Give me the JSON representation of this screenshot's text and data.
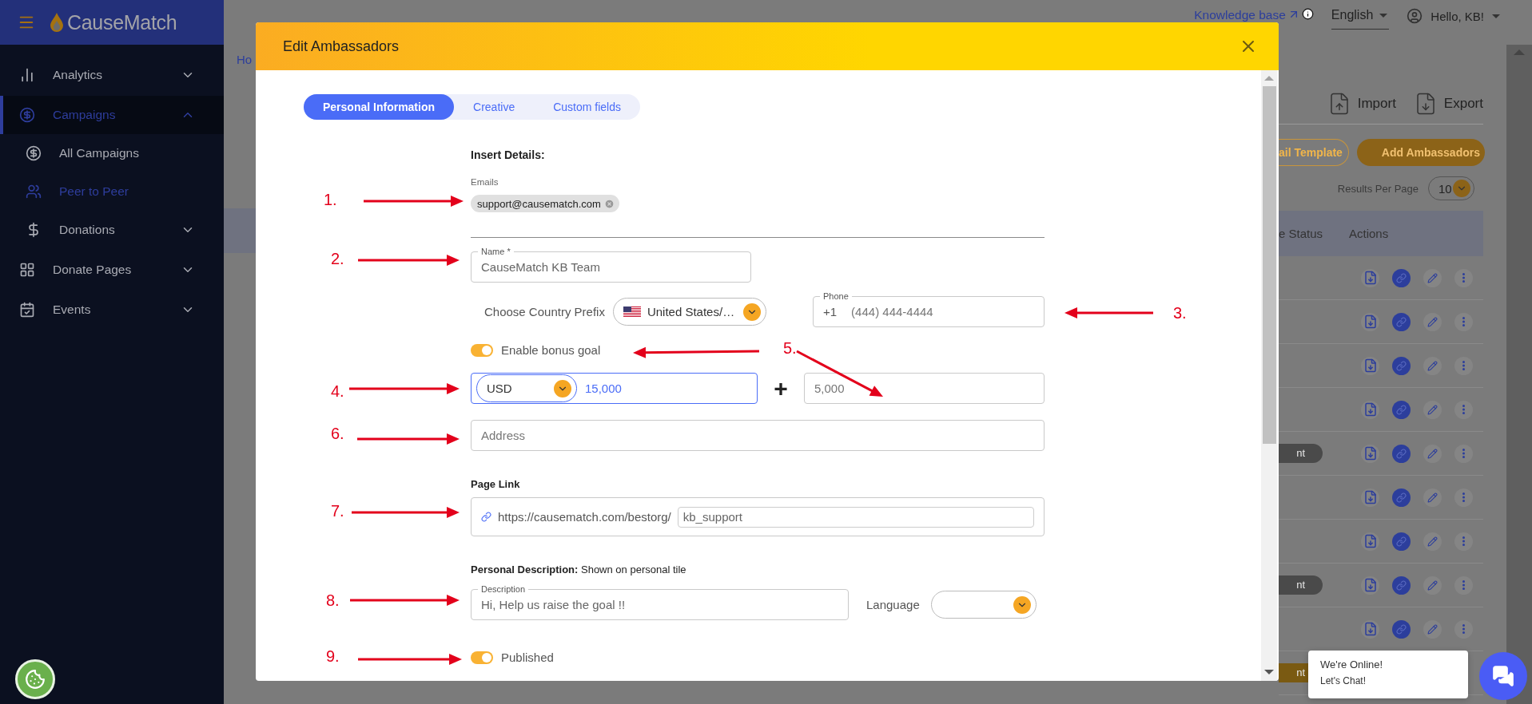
{
  "sidebar": {
    "brand": "CauseMatch",
    "items": [
      {
        "label": "Analytics",
        "selected": false,
        "expanded": false
      },
      {
        "label": "Campaigns",
        "selected": true,
        "expanded": true,
        "children": [
          {
            "label": "All Campaigns",
            "selected": false
          },
          {
            "label": "Peer to Peer",
            "selected": true
          },
          {
            "label": "Donations",
            "selected": false,
            "expanded": false
          }
        ]
      },
      {
        "label": "Donate Pages",
        "selected": false,
        "expanded": false
      },
      {
        "label": "Events",
        "selected": false,
        "expanded": false
      }
    ]
  },
  "topbar": {
    "knowledge_base": "Knowledge base",
    "language": "English",
    "user": "Hello, KB!"
  },
  "background": {
    "breadcrumb": "Ho",
    "import": "Import",
    "export": "Export",
    "template_button": "ail Template",
    "add_button": "Add Ambassadors",
    "results_per_page": {
      "label": "Results Per Page",
      "value": "10"
    },
    "table": {
      "columns": [
        "e Status",
        "Actions"
      ],
      "rows": [
        {},
        {},
        {},
        {},
        {
          "status": "nt",
          "color": "#4a4a4a"
        },
        {},
        {},
        {
          "status": "nt",
          "color": "#4a4a4a"
        },
        {}
      ],
      "last_row": {
        "status": "nt",
        "color": "#7a5a12"
      }
    }
  },
  "dialog": {
    "title": "Edit Ambassadors",
    "tabs": [
      {
        "label": "Personal Information",
        "selected": true
      },
      {
        "label": "Creative",
        "selected": false
      },
      {
        "label": "Custom fields",
        "selected": false
      }
    ],
    "insert_details": "Insert Details:",
    "emails": {
      "label": "Emails",
      "chips": [
        "support@causematch.com"
      ]
    },
    "name": {
      "label": "Name *",
      "value": "CauseMatch KB Team"
    },
    "country_prefix": {
      "label": "Choose Country Prefix",
      "value": "United States/…"
    },
    "phone": {
      "label": "Phone",
      "prefix": "+1",
      "placeholder": "(444) 444-4444"
    },
    "bonus_goal": {
      "label": "Enable bonus goal",
      "on": true
    },
    "goal": {
      "currency": "USD",
      "value": "15,000",
      "plus": "+"
    },
    "bonus": {
      "placeholder": "5,000"
    },
    "address": {
      "placeholder": "Address"
    },
    "page_link": {
      "label": "Page Link",
      "base": "https://causematch.com/bestorg/",
      "value": "kb_support"
    },
    "personal_description": "**Personal Description:**  Shown on personal tile",
    "description": {
      "label": "Description",
      "value": "Hi, Help us raise the goal !!"
    },
    "language": {
      "label": "Language"
    },
    "published": {
      "label": "Published",
      "on": true
    }
  },
  "annotations": [
    {
      "number": "1."
    },
    {
      "number": "2."
    },
    {
      "number": "3."
    },
    {
      "number": "4."
    },
    {
      "number": "5."
    },
    {
      "number": "6."
    },
    {
      "number": "7."
    },
    {
      "number": "8."
    },
    {
      "number": "9."
    }
  ],
  "chat": {
    "title": "We're Online!",
    "subtitle": "Let's Chat!"
  }
}
